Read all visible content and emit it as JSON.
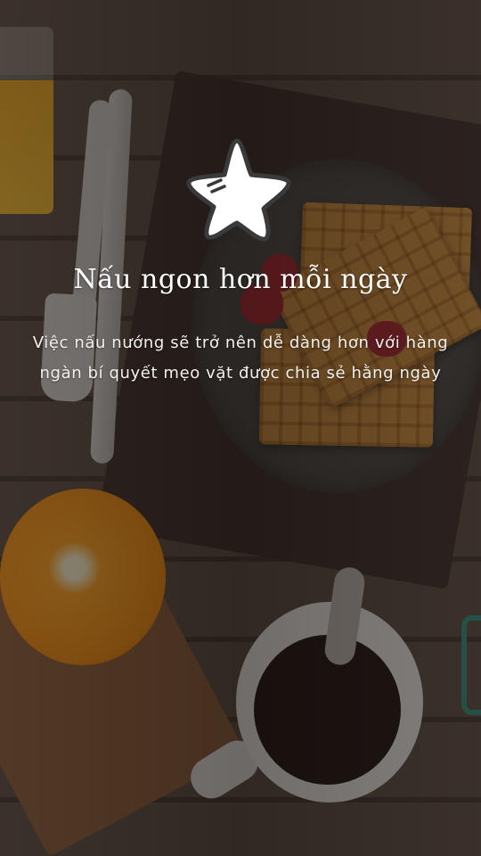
{
  "onboarding": {
    "title": "Nấu ngon hơn mỗi ngày",
    "description_lines": [
      "Việc nấu nướng sẽ trở nên dễ dàng hơn với hàng",
      "ngàn bí quyết mẹo vặt được chia sẻ hằng ngày"
    ],
    "logo_icon": "star-icon",
    "background": "breakfast-table-photo"
  },
  "colors": {
    "text": "#ffffff",
    "overlay": "rgba(22,18,16,0.50)"
  }
}
